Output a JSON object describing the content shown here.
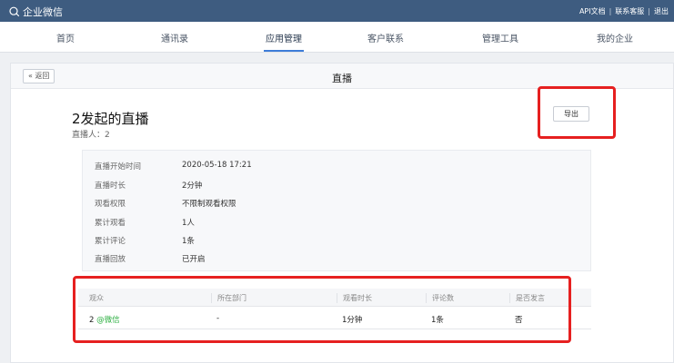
{
  "topbar": {
    "app_name": "企业微信",
    "links": [
      "API文档",
      "联系客服",
      "退出"
    ]
  },
  "nav": {
    "items": [
      "首页",
      "通讯录",
      "应用管理",
      "客户联系",
      "管理工具",
      "我的企业"
    ],
    "active": "应用管理"
  },
  "panel": {
    "back_label": "« 返回",
    "title": "直播"
  },
  "live": {
    "title": "2发起的直播",
    "host": "直播人：2",
    "export_label": "导出"
  },
  "info": [
    {
      "label": "直播开始时间",
      "value": "2020-05-18 17:21"
    },
    {
      "label": "直播时长",
      "value": "2分钟"
    },
    {
      "label": "观看权限",
      "value": "不限制观看权限"
    },
    {
      "label": "累计观看",
      "value": "1人"
    },
    {
      "label": "累计评论",
      "value": "1条"
    },
    {
      "label": "直播回放",
      "value": "已开启"
    }
  ],
  "table": {
    "headers": [
      "观众",
      "所在部门",
      "观看时长",
      "评论数",
      "是否发言"
    ],
    "rows": [
      {
        "viewer": "2",
        "viewer_tag": "@微信",
        "department": "-",
        "duration": "1分钟",
        "comments": "1条",
        "spoke": "否"
      }
    ]
  },
  "colors": {
    "topbar": "#3e5c80",
    "accent": "#3e7dd8",
    "highlight": "#e62020",
    "wechat": "#2aae3f"
  }
}
